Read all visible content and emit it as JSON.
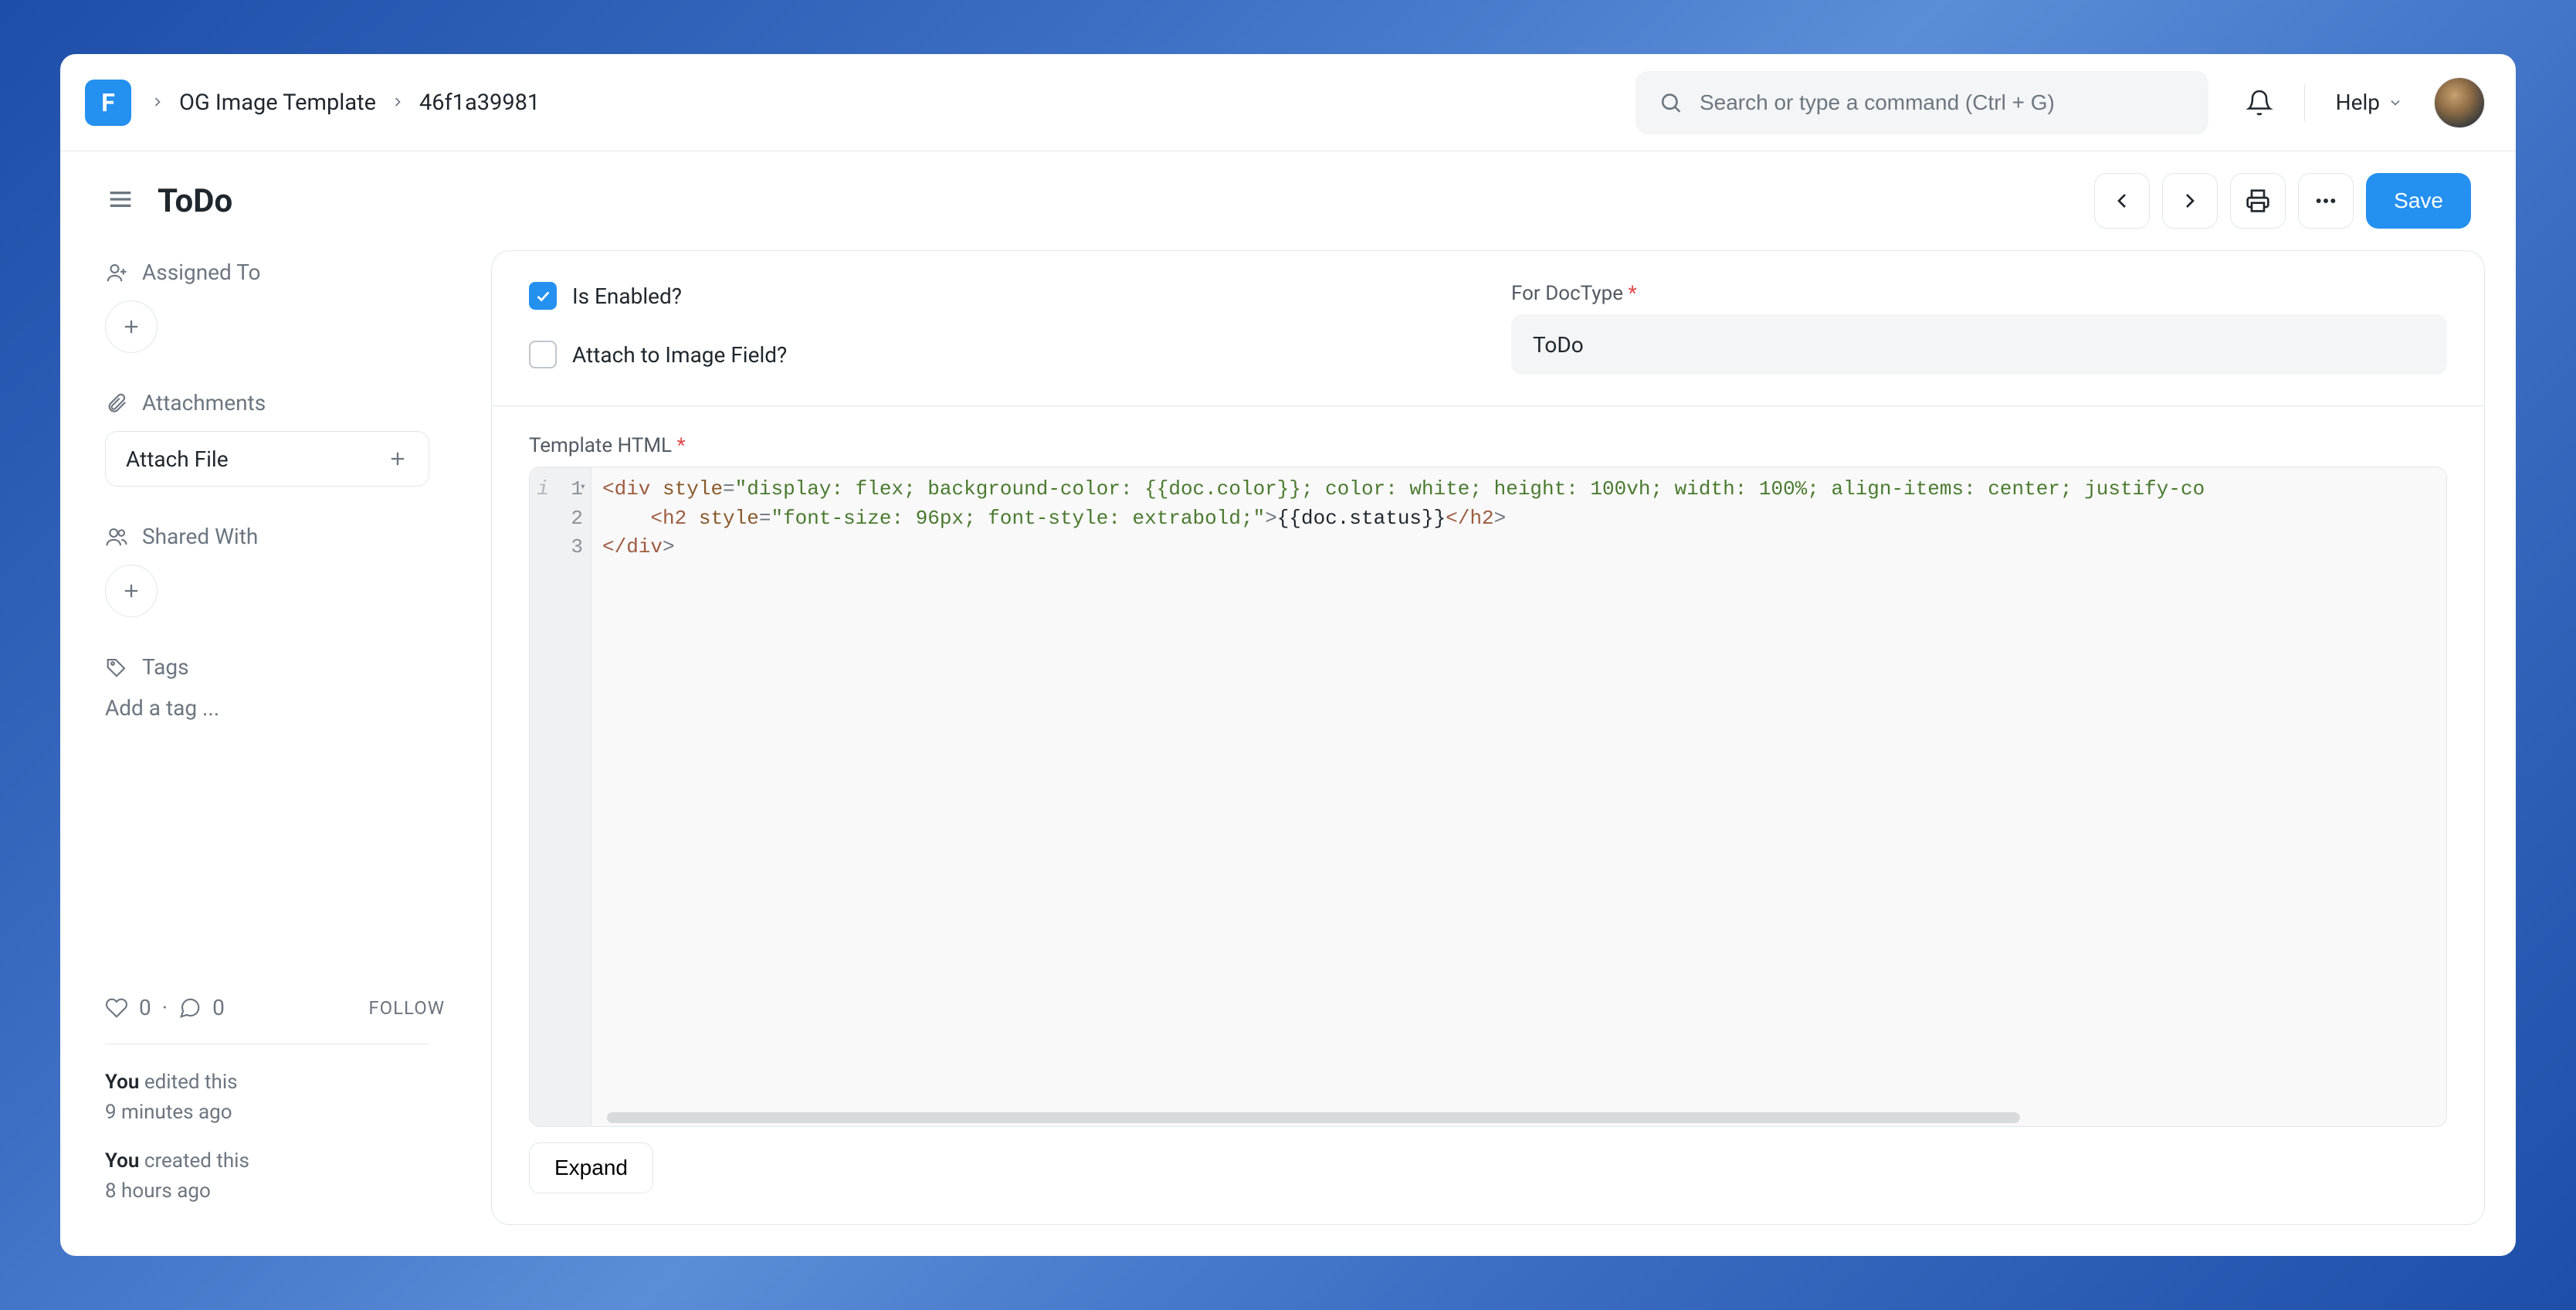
{
  "breadcrumbs": {
    "parent": "OG Image Template",
    "current": "46f1a39981"
  },
  "search": {
    "placeholder": "Search or type a command (Ctrl + G)"
  },
  "help_label": "Help",
  "page": {
    "title": "ToDo",
    "save_label": "Save"
  },
  "sidebar": {
    "assigned_to": "Assigned To",
    "attachments": "Attachments",
    "attach_file": "Attach File",
    "shared_with": "Shared With",
    "tags": "Tags",
    "tag_placeholder": "Add a tag ...",
    "likes": "0",
    "comments": "0",
    "separator": "·",
    "follow": "FOLLOW",
    "timeline": [
      {
        "who": "You",
        "action": "edited this",
        "when": "9 minutes ago"
      },
      {
        "who": "You",
        "action": "created this",
        "when": "8 hours ago"
      }
    ]
  },
  "form": {
    "is_enabled_label": "Is Enabled?",
    "is_enabled_checked": true,
    "attach_image_label": "Attach to Image Field?",
    "attach_image_checked": false,
    "for_doctype_label": "For DocType",
    "for_doctype_value": "ToDo",
    "template_html_label": "Template HTML",
    "expand_label": "Expand"
  },
  "code": {
    "line1": {
      "tag_open": "<div",
      "attr": "style",
      "eq": "=",
      "str": "\"display: flex; background-color: {{doc.color}}; color: white; height: 100vh; width: 100%; align-items: center; justify-co",
      "gutter_info": "i"
    },
    "line2": {
      "indent": "    ",
      "tag_open": "<h2",
      "attr": "style",
      "eq": "=",
      "str": "\"font-size: 96px; font-style: extrabold;\"",
      "gt": ">",
      "text": "{{doc.status}}",
      "tag_close": "</h2",
      "gt2": ">"
    },
    "line3": {
      "tag_close": "</div",
      "gt": ">"
    }
  }
}
